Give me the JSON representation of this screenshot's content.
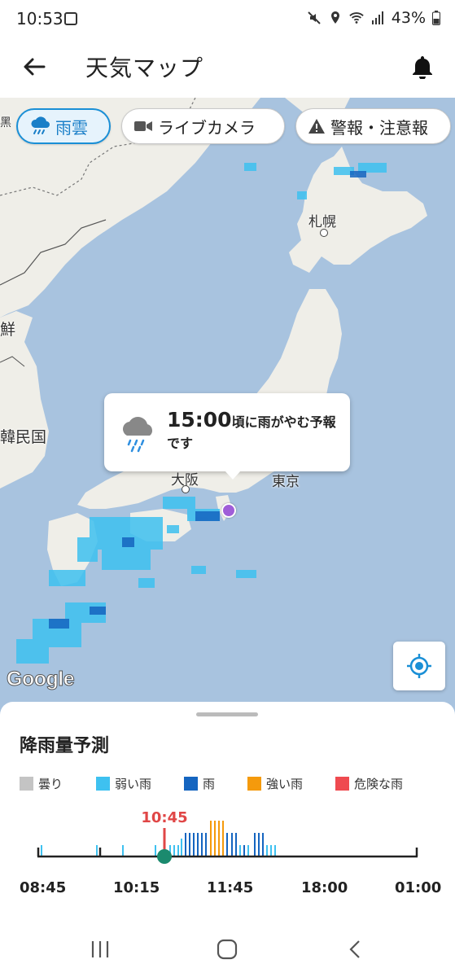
{
  "status": {
    "time": "10:53",
    "battery": "43%",
    "icons": [
      "image-icon",
      "mute-icon",
      "location-icon",
      "wifi-icon",
      "signal-icon",
      "battery-icon"
    ]
  },
  "appbar": {
    "title": "天気マップ"
  },
  "filters": [
    {
      "label": "雨雲",
      "icon": "rain-cloud-icon",
      "active": true
    },
    {
      "label": "ライブカメラ",
      "icon": "video-camera-icon",
      "active": false
    },
    {
      "label": "警報・注意報",
      "icon": "warning-icon",
      "active": false
    }
  ],
  "map": {
    "cities": {
      "sapporo": "札幌",
      "osaka": "大阪",
      "tokyo": "東京",
      "korea": "韓民国",
      "north": "鮮",
      "top_left": "黑"
    },
    "popup": {
      "time": "15:00",
      "text": "頃に雨がやむ予報です"
    },
    "attribution": "Google"
  },
  "forecast": {
    "title": "降雨量予測",
    "legend": [
      {
        "label": "曇り",
        "color": "#c4c4c4"
      },
      {
        "label": "弱い雨",
        "color": "#3ec1f0"
      },
      {
        "label": "雨",
        "color": "#1565c0"
      },
      {
        "label": "強い雨",
        "color": "#f59a0c"
      },
      {
        "label": "危険な雨",
        "color": "#ef4a50"
      }
    ],
    "current_time": "10:45",
    "axis_labels": [
      "08:45",
      "10:15",
      "11:45",
      "18:00",
      "01:00"
    ]
  },
  "colors": {
    "accent": "#1a8fd6",
    "now_marker": "#1b8a6e",
    "now_line": "#e04646"
  }
}
